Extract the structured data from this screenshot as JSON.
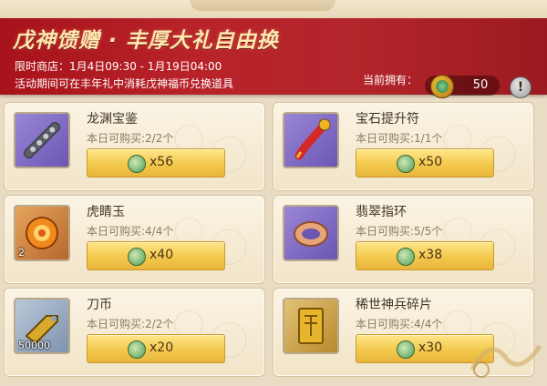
{
  "banner": {
    "title": "戊神馈赠 · 丰厚大礼自由换",
    "period": "限时商店：1月4日09:30 - 1月19日04:00",
    "note": "活动期间可在丰年礼中消耗戊神福币兑换道具",
    "owned_label": "当前拥有：",
    "owned_value": "50",
    "info_button": "!"
  },
  "items": [
    {
      "name": "龙渊宝鉴",
      "limit": "本日可购买:2/2个",
      "price": "x56",
      "qty": "",
      "icon": "bead-sword-icon",
      "bg": "#8b76c8"
    },
    {
      "name": "宝石提升符",
      "limit": "本日可购买:1/1个",
      "price": "x50",
      "qty": "",
      "icon": "red-talisman-icon",
      "bg": "#8b76c8"
    },
    {
      "name": "虎睛玉",
      "limit": "本日可购买:4/4个",
      "price": "x40",
      "qty": "2",
      "icon": "tiger-eye-jade-icon",
      "bg": "#d8904f"
    },
    {
      "name": "翡翠指环",
      "limit": "本日可购买:5/5个",
      "price": "x38",
      "qty": "",
      "icon": "jade-ring-icon",
      "bg": "#8b76c8"
    },
    {
      "name": "刀币",
      "limit": "本日可购买:2/2个",
      "price": "x20",
      "qty": "50000",
      "icon": "knife-coin-icon",
      "bg": "#9fb1c6"
    },
    {
      "name": "稀世神兵碎片",
      "limit": "本日可购买:4/4个",
      "price": "x30",
      "qty": "",
      "icon": "divine-weapon-shard-icon",
      "bg": "#d2b25c"
    }
  ]
}
